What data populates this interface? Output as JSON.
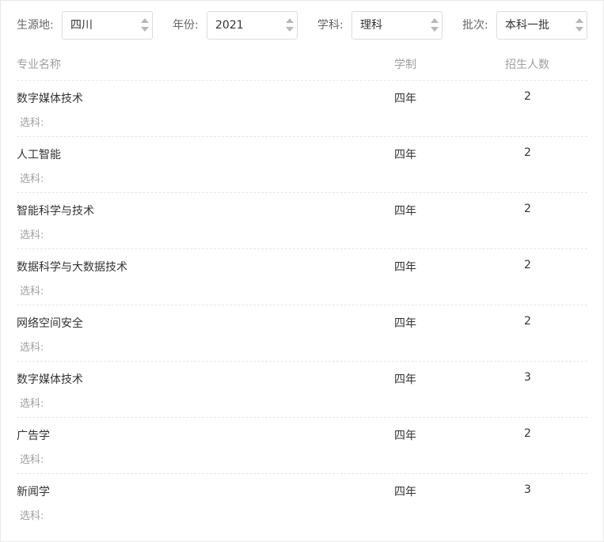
{
  "filters": {
    "origin": {
      "label": "生源地:",
      "value": "四川"
    },
    "year": {
      "label": "年份:",
      "value": "2021"
    },
    "subject": {
      "label": "学科:",
      "value": "理科"
    },
    "batch": {
      "label": "批次:",
      "value": "本科一批"
    }
  },
  "table": {
    "headers": {
      "name": "专业名称",
      "years": "学制",
      "count": "招生人数"
    },
    "subject_label": "选科:",
    "rows": [
      {
        "name": "数字媒体技术",
        "years": "四年",
        "count": "2"
      },
      {
        "name": "人工智能",
        "years": "四年",
        "count": "2"
      },
      {
        "name": "智能科学与技术",
        "years": "四年",
        "count": "2"
      },
      {
        "name": "数据科学与大数据技术",
        "years": "四年",
        "count": "2"
      },
      {
        "name": "网络空间安全",
        "years": "四年",
        "count": "2"
      },
      {
        "name": "数字媒体技术",
        "years": "四年",
        "count": "3"
      },
      {
        "name": "广告学",
        "years": "四年",
        "count": "2"
      },
      {
        "name": "新闻学",
        "years": "四年",
        "count": "3"
      }
    ]
  }
}
